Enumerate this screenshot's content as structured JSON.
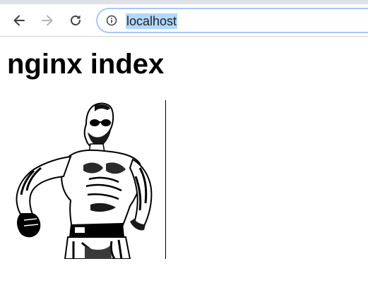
{
  "browser": {
    "address_bar": {
      "url": "localhost"
    },
    "icons": {
      "back": "arrow-left-icon",
      "forward": "arrow-right-icon",
      "reload": "reload-icon",
      "site_info": "info-circle-icon"
    },
    "colors": {
      "url_selection": "#b3d7ff",
      "omnibox_border": "#a8c7fa"
    }
  },
  "page": {
    "heading": "nginx index",
    "image": {
      "subject": "black-and-white illustration of a tattooed, bearded fighter in sunglasses and fight shorts walking forward"
    }
  }
}
